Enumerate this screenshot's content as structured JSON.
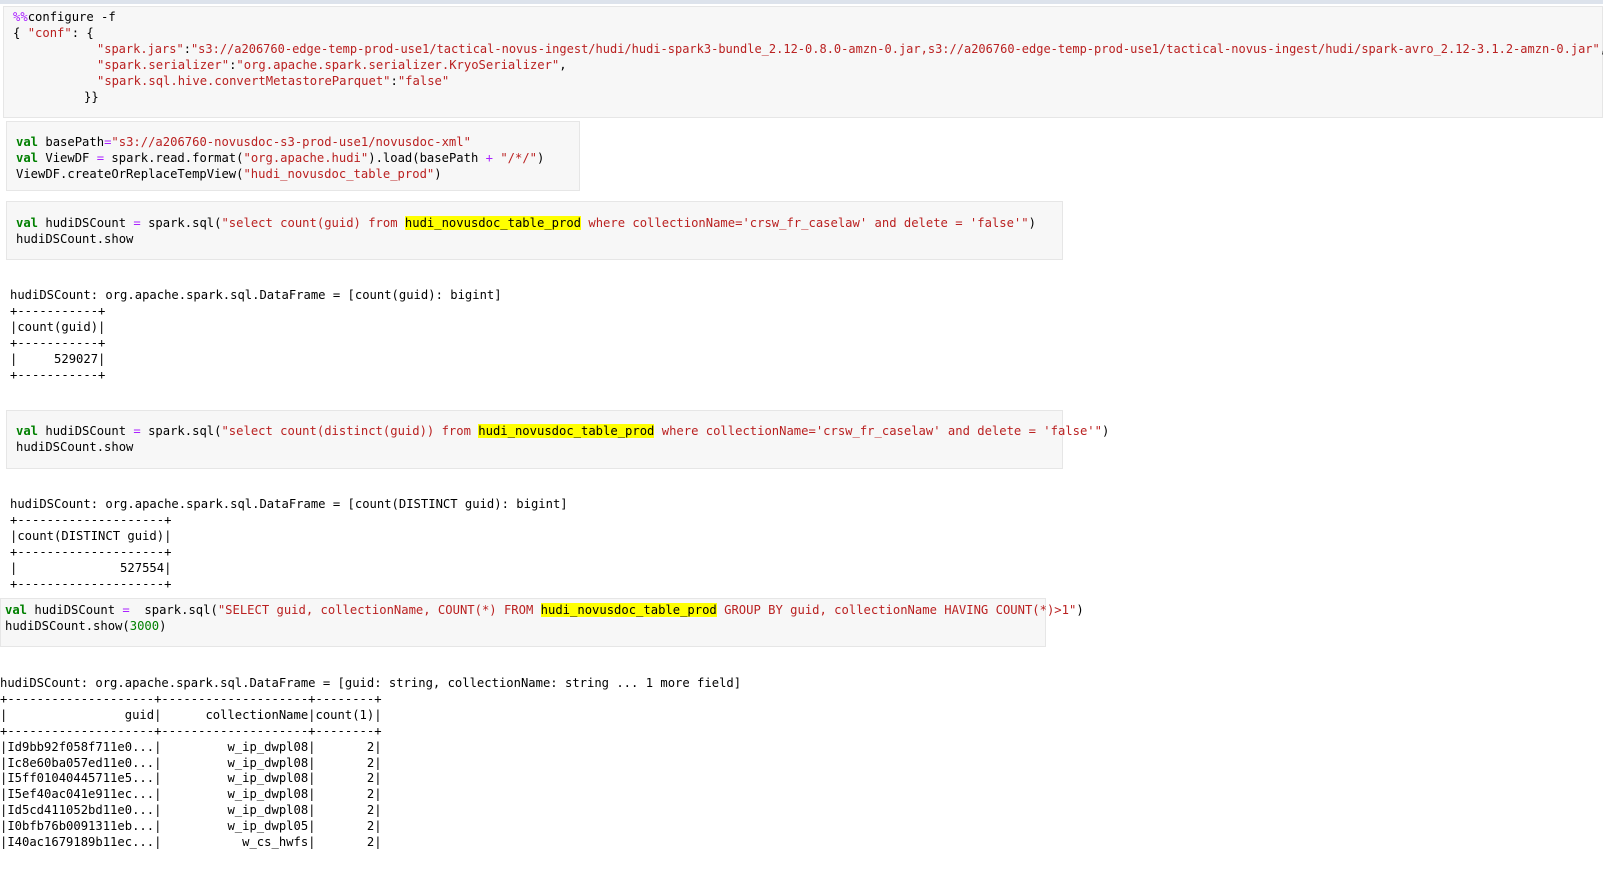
{
  "cell1": {
    "magic": "%%",
    "magic_rest": "configure -f",
    "line2_open": "{ ",
    "line2_key": "\"conf\"",
    "line2_rest": ": {",
    "line3_key": "\"spark.jars\"",
    "line3_colon": ":",
    "line3_val": "\"s3://a206760-edge-temp-prod-use1/tactical-novus-ingest/hudi/hudi-spark3-bundle_2.12-0.8.0-amzn-0.jar,s3://a206760-edge-temp-prod-use1/tactical-novus-ingest/hudi/spark-avro_2.12-3.1.2-amzn-0.jar\"",
    "line3_end": ",",
    "line4_key": "\"spark.serializer\"",
    "line4_colon": ":",
    "line4_val": "\"org.apache.spark.serializer.KryoSerializer\"",
    "line4_end": ",",
    "line5_key": "\"spark.sql.hive.convertMetastoreParquet\"",
    "line5_colon": ":",
    "line5_val": "\"false\"",
    "line6": "}}"
  },
  "cell2": {
    "l1_kw": "val",
    "l1_name": " basePath",
    "l1_eq": "=",
    "l1_str": "\"s3://a206760-novusdoc-s3-prod-use1/novusdoc-xml\"",
    "l2_kw": "val",
    "l2_name": " ViewDF ",
    "l2_eq": "=",
    "l2_a": " spark.read.format(",
    "l2_str1": "\"org.apache.hudi\"",
    "l2_b": ").load(basePath ",
    "l2_plus": "+",
    "l2_c": " ",
    "l2_str2": "\"/*/\"",
    "l2_d": ")",
    "l3_a": "ViewDF.createOrReplaceTempView(",
    "l3_str": "\"hudi_novusdoc_table_prod\"",
    "l3_b": ")"
  },
  "cell3": {
    "kw": "val",
    "name": " hudiDSCount ",
    "eq": "=",
    "a": " spark.sql(",
    "s1": "\"select count(guid) from ",
    "hl": "hudi_novusdoc_table_prod",
    "s2": " where collectionName='crsw_fr_caselaw' and delete = 'false'\"",
    "b": ")",
    "line2": "hudiDSCount.show"
  },
  "out3": {
    "text": "hudiDSCount: org.apache.spark.sql.DataFrame = [count(guid): bigint]\n+-----------+\n|count(guid)|\n+-----------+\n|     529027|\n+-----------+"
  },
  "cell4": {
    "kw": "val",
    "name": " hudiDSCount ",
    "eq": "=",
    "a": " spark.sql(",
    "s1": "\"select count(distinct(guid)) from ",
    "hl": "hudi_novusdoc_table_prod",
    "s2": " where collectionName='crsw_fr_caselaw' and delete = 'false'\"",
    "b": ")",
    "line2": "hudiDSCount.show"
  },
  "out4": {
    "text": "hudiDSCount: org.apache.spark.sql.DataFrame = [count(DISTINCT guid): bigint]\n+--------------------+\n|count(DISTINCT guid)|\n+--------------------+\n|              527554|\n+--------------------+"
  },
  "cell5": {
    "kw": "val",
    "name": " hudiDSCount ",
    "eq": "=",
    "a": "  spark.sql(",
    "s1": "\"SELECT guid, collectionName, COUNT(*) FROM ",
    "hl": "hudi_novusdoc_table_prod",
    "s2": " GROUP BY guid, collectionName HAVING COUNT(*)>1\"",
    "b": ")",
    "l2_a": "hudiDSCount.show(",
    "l2_num": "3000",
    "l2_b": ")"
  },
  "out5": {
    "text": "hudiDSCount: org.apache.spark.sql.DataFrame = [guid: string, collectionName: string ... 1 more field]\n+--------------------+--------------------+--------+\n|                guid|      collectionName|count(1)|\n+--------------------+--------------------+--------+\n|Id9bb92f058f711e0...|         w_ip_dwpl08|       2|\n|Ic8e60ba057ed11e0...|         w_ip_dwpl08|       2|\n|I5ff01040445711e5...|         w_ip_dwpl08|       2|\n|I5ef40ac041e911ec...|         w_ip_dwpl08|       2|\n|Id5cd411052bd11e0...|         w_ip_dwpl08|       2|\n|I0bfb76b0091311eb...|         w_ip_dwpl05|       2|\n|I40ac1679189b11ec...|           w_cs_hwfs|       2|"
  }
}
